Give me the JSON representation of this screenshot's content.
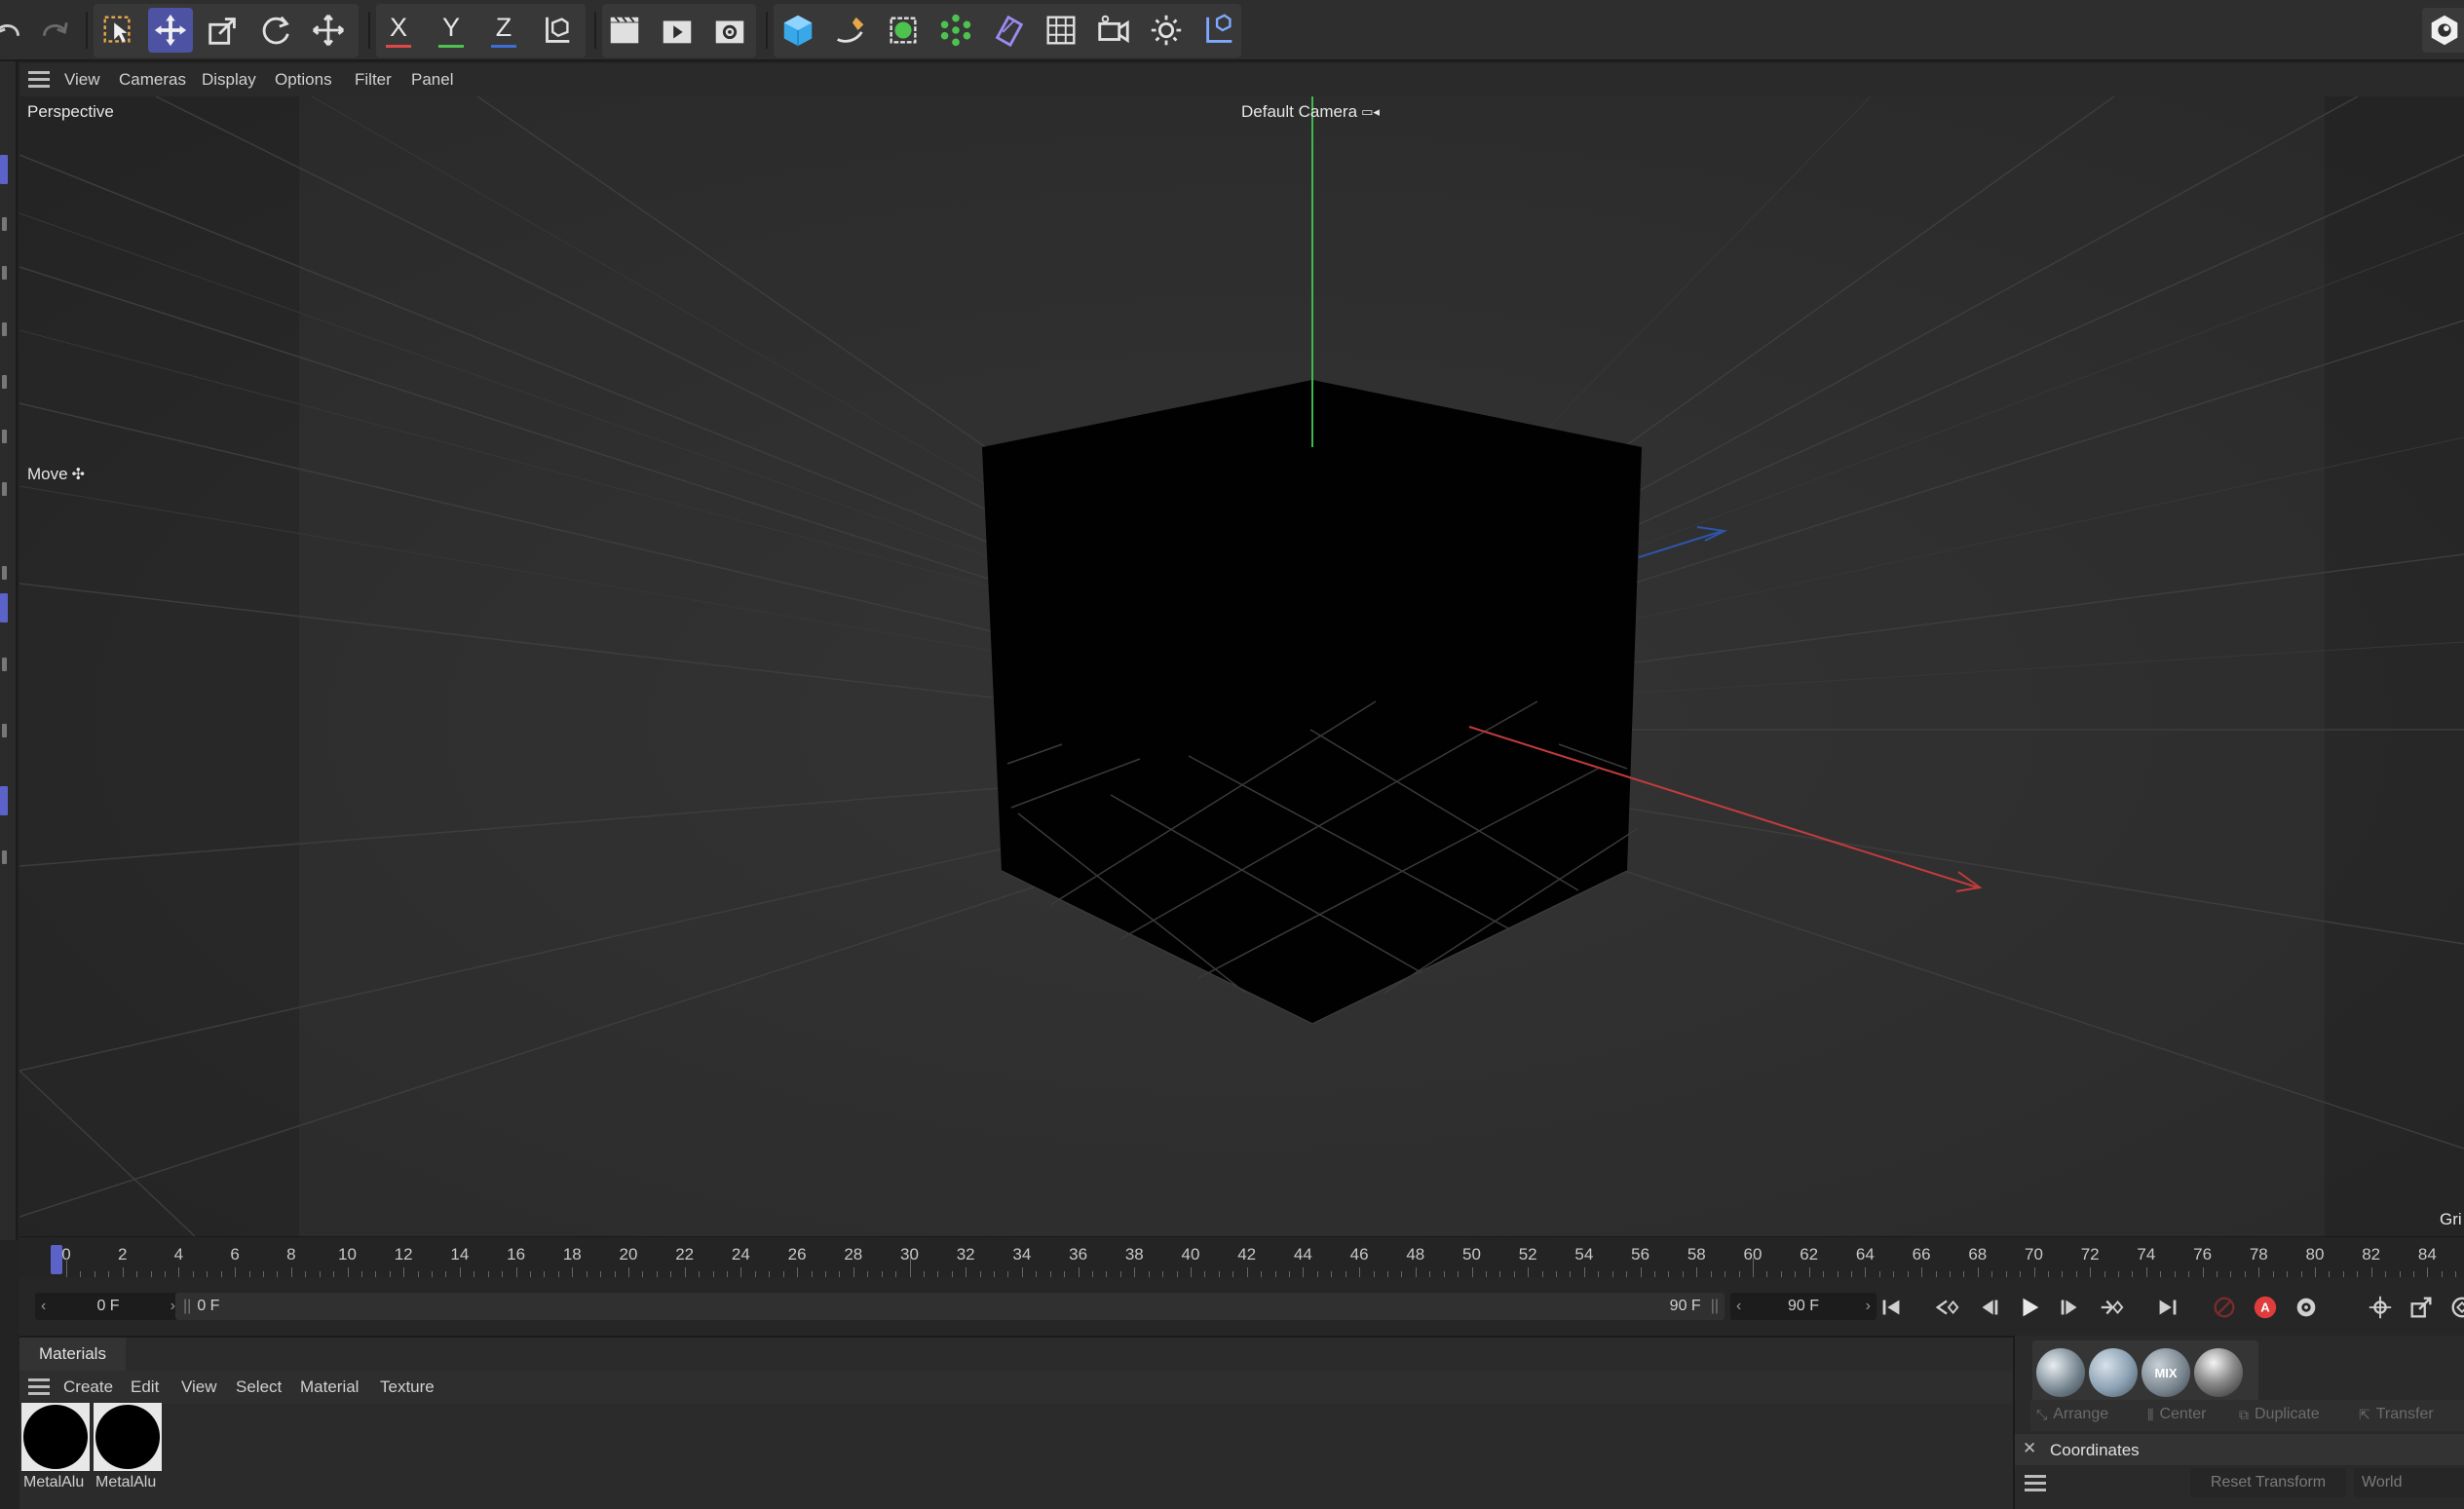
{
  "toolbar": {
    "icons": [
      "undo-icon",
      "redo-icon",
      "live-selection-icon",
      "move-icon",
      "scale-icon",
      "rotate-icon",
      "transform-icon",
      "x-axis-lock-icon",
      "y-axis-lock-icon",
      "z-axis-lock-icon",
      "coordinate-system-icon",
      "render-view-icon",
      "render-picture-viewer-icon",
      "render-settings-icon",
      "cube-icon",
      "spline-pen-icon",
      "subdivision-surface-icon",
      "cloner-icon",
      "deformer-icon",
      "floor-icon",
      "camera-icon",
      "light-icon",
      "scene-tags-icon",
      "cinema4d-logo-icon"
    ],
    "axis_x": "X",
    "axis_y": "Y",
    "axis_z": "Z"
  },
  "viewport_menu": {
    "items": [
      "View",
      "Cameras",
      "Display",
      "Options",
      "Filter",
      "Panel"
    ]
  },
  "viewport": {
    "view_name": "Perspective",
    "camera_label": "Default Camera",
    "tool_label": "Move",
    "grid_label": "Gri"
  },
  "timeline": {
    "ticks": [
      "0",
      "2",
      "4",
      "6",
      "8",
      "10",
      "12",
      "14",
      "16",
      "18",
      "20",
      "22",
      "24",
      "26",
      "28",
      "30",
      "32",
      "34",
      "36",
      "38",
      "40",
      "42",
      "44",
      "46",
      "48",
      "50",
      "52",
      "54",
      "56",
      "58",
      "60",
      "62",
      "64",
      "66",
      "68",
      "70",
      "72",
      "74",
      "76",
      "78",
      "80",
      "82",
      "84",
      "8"
    ],
    "current_frame": "0 F",
    "range_start": "0 F",
    "range_end": "90 F",
    "end_frame": "90 F"
  },
  "materials": {
    "tab": "Materials",
    "menu": [
      "Create",
      "Edit",
      "View",
      "Select",
      "Material",
      "Texture"
    ],
    "items": [
      {
        "name": "MetalAlu"
      },
      {
        "name": "MetalAlu"
      }
    ]
  },
  "right_panel": {
    "arrange": "Arrange",
    "center": "Center",
    "duplicate": "Duplicate",
    "transfer": "Transfer",
    "coordinates_tab": "Coordinates",
    "reset_transform": "Reset Transform",
    "world": "World",
    "mix_label": "MIX"
  },
  "colors": {
    "accent": "#4d52a3",
    "x_axis": "#e04848",
    "y_axis": "#4ec24e",
    "z_axis": "#3b6fd6",
    "record": "#e03c3c"
  }
}
